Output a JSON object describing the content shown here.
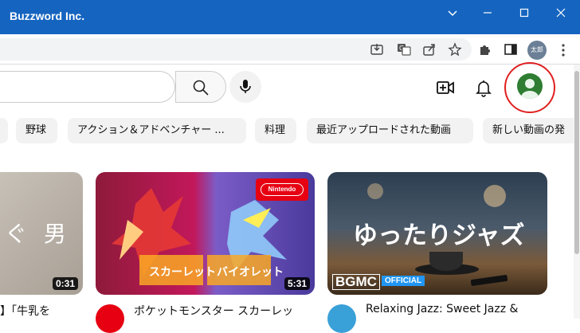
{
  "window": {
    "title": "Buzzword Inc."
  },
  "toolbar": {
    "profile_badge": "太郎"
  },
  "chips": [
    "野球",
    "アクション＆アドベンチャー ...",
    "料理",
    "最近アップロードされた動画",
    "新しい動画の発"
  ],
  "videos": [
    {
      "thumb_text": "ぐ 男",
      "duration": "0:31",
      "title": "】「牛乳を"
    },
    {
      "thumb_brand": "Nintendo",
      "duration": "5:31",
      "title": "ポケットモンスター スカーレッ"
    },
    {
      "thumb_text": "ゆったりジャズ",
      "thumb_brand": "BGMC",
      "thumb_badge": "OFFICIAL",
      "title": "Relaxing Jazz: Sweet Jazz &"
    }
  ]
}
